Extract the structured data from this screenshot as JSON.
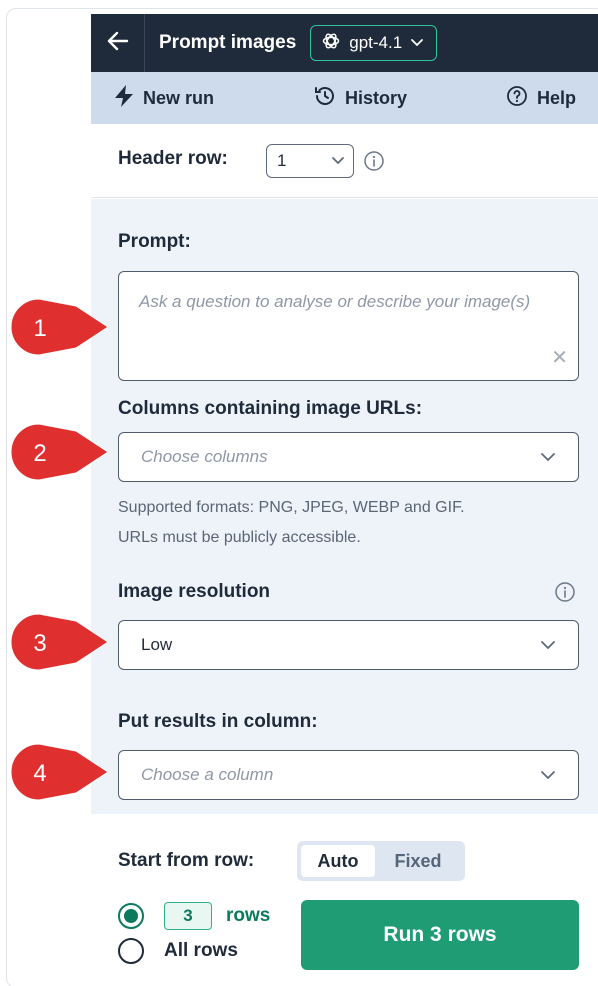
{
  "header": {
    "title": "Prompt images",
    "model": "gpt-4.1"
  },
  "nav": {
    "new_run": "New run",
    "history": "History",
    "help": "Help"
  },
  "header_row": {
    "label": "Header row:",
    "value": "1"
  },
  "prompt": {
    "label": "Prompt:",
    "placeholder": "Ask a question to analyse or describe your image(s)"
  },
  "columns": {
    "label": "Columns containing image URLs:",
    "placeholder": "Choose columns",
    "help_line1": "Supported formats: PNG, JPEG, WEBP and GIF.",
    "help_line2": "URLs must be publicly accessible."
  },
  "resolution": {
    "label": "Image resolution",
    "value": "Low"
  },
  "output": {
    "label": "Put results in column:",
    "placeholder": "Choose a column"
  },
  "start": {
    "label": "Start from row:",
    "auto": "Auto",
    "fixed": "Fixed",
    "selected": "Auto"
  },
  "rows": {
    "count": "3",
    "rows_label": "rows",
    "all_rows_label": "All rows",
    "selected": "count"
  },
  "run_button": "Run 3 rows",
  "callouts": [
    "1",
    "2",
    "3",
    "4"
  ],
  "colors": {
    "header_bg": "#1f2b3a",
    "accent": "#1f9c73",
    "callout_red": "#e02f2f"
  },
  "icons": {
    "back": "arrow-left-icon",
    "model": "openai-logo-icon",
    "new_run": "lightning-icon",
    "history": "history-icon",
    "help": "help-circle-icon",
    "info": "info-icon",
    "chevron": "chevron-down-icon",
    "clear": "close-icon"
  }
}
